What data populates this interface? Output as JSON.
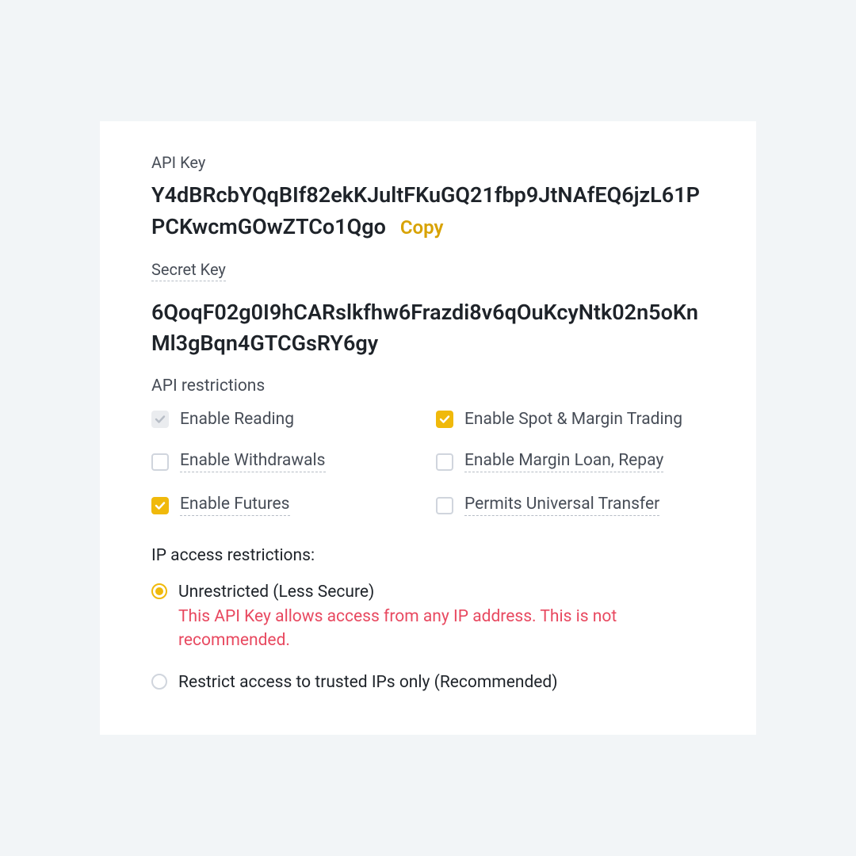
{
  "apiKey": {
    "label": "API Key",
    "value": "Y4dBRcbYQqBIf82ekKJultFKuGQ21fbp9JtNAfEQ6jzL61PPCKwcmGOwZTCo1Qgo",
    "copy": "Copy"
  },
  "secretKey": {
    "label": "Secret Key",
    "value": "6QoqF02g0I9hCARslkfhw6Frazdi8v6qOuKcyNtk02n5oKnMl3gBqn4GTCGsRY6gy"
  },
  "restrictions": {
    "title": "API restrictions",
    "items": [
      {
        "label": "Enable Reading",
        "state": "checked-gray",
        "dotted": false
      },
      {
        "label": "Enable Spot & Margin Trading",
        "state": "checked-yellow",
        "dotted": false
      },
      {
        "label": "Enable Withdrawals",
        "state": "unchecked",
        "dotted": true
      },
      {
        "label": "Enable Margin Loan, Repay",
        "state": "unchecked",
        "dotted": true
      },
      {
        "label": "Enable Futures",
        "state": "checked-yellow",
        "dotted": true
      },
      {
        "label": "Permits Universal Transfer",
        "state": "unchecked",
        "dotted": true
      }
    ]
  },
  "ip": {
    "title": "IP access restrictions:",
    "option1": {
      "label": "Unrestricted (Less Secure)",
      "warning": "This API Key allows access from any IP address. This is not recommended.",
      "selected": true
    },
    "option2": {
      "label": "Restrict access to trusted IPs only (Recommended)",
      "selected": false
    }
  }
}
